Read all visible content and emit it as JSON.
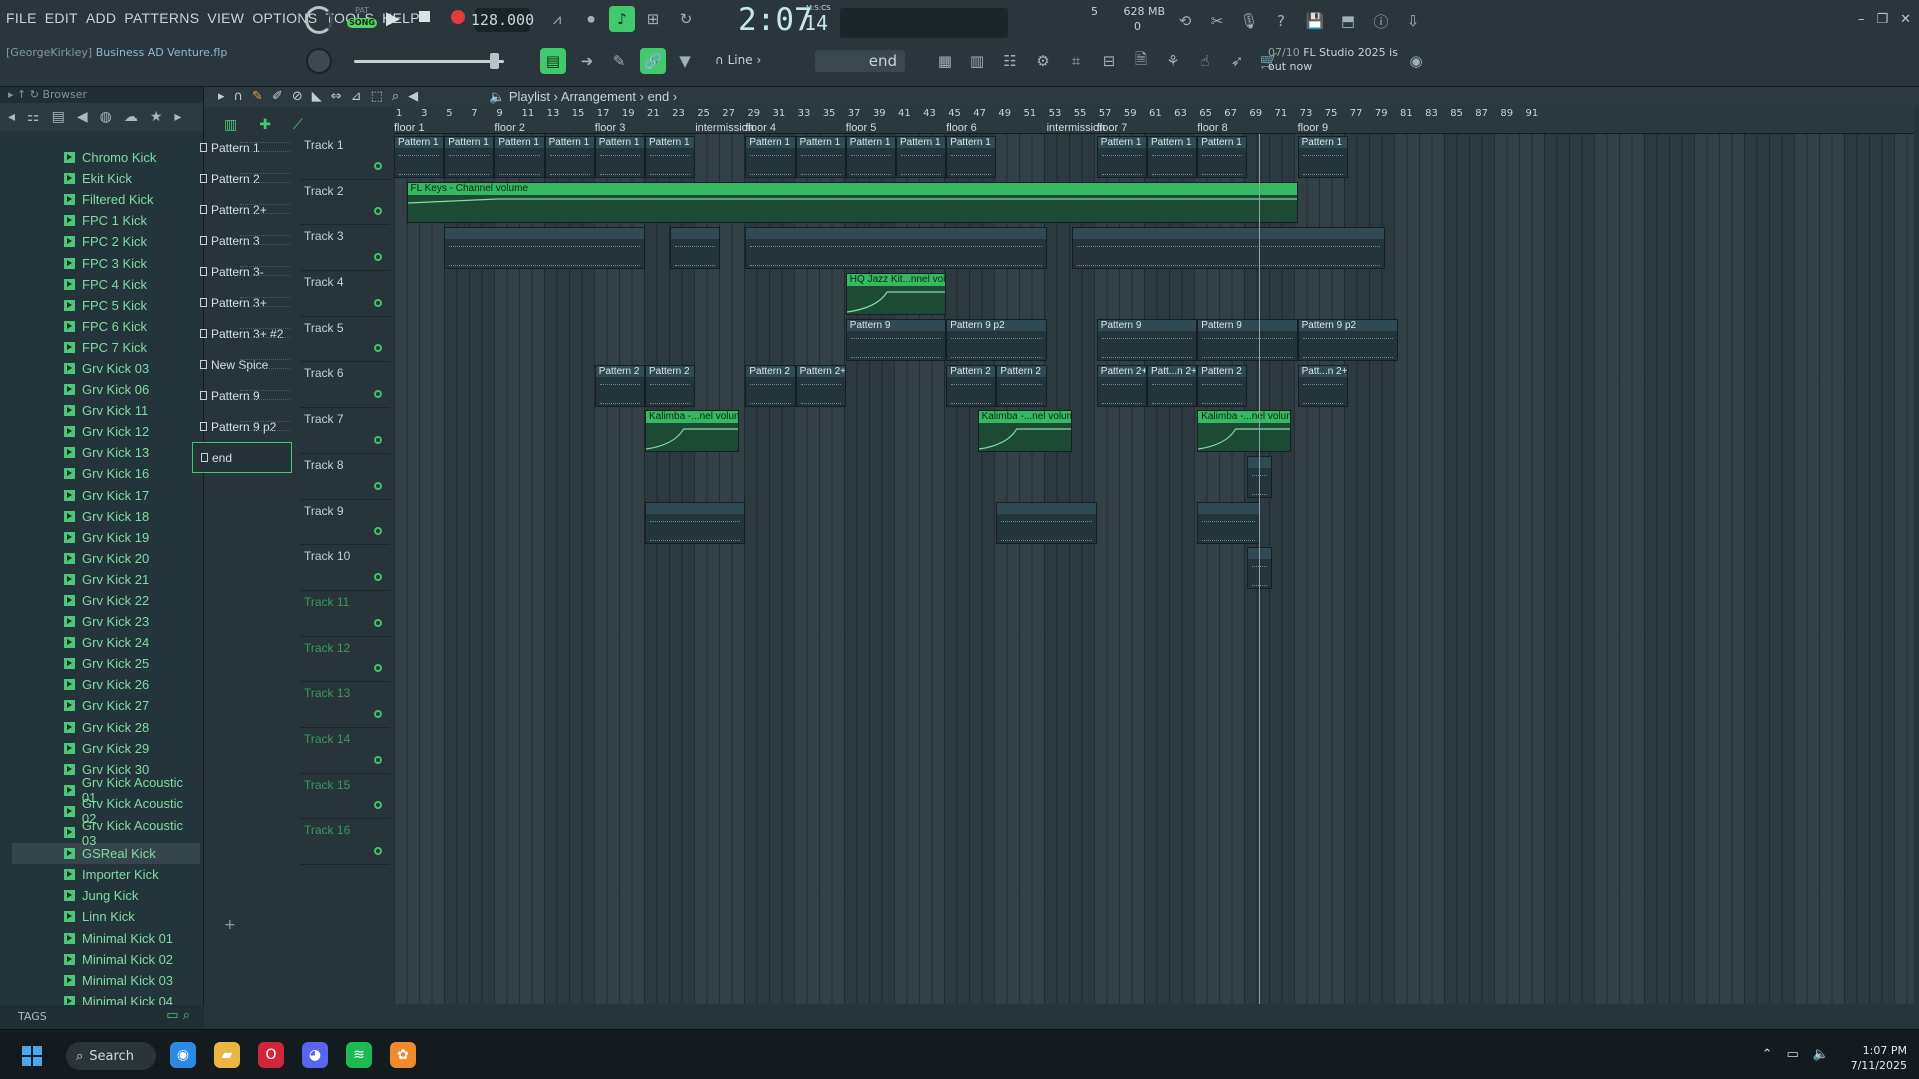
{
  "menu": [
    "FILE",
    "EDIT",
    "ADD",
    "PATTERNS",
    "VIEW",
    "OPTIONS",
    "TOOLS",
    "HELP"
  ],
  "transport": {
    "pat_label": "PAT",
    "song_label": "SONG",
    "tempo": "128.000",
    "time_main": "2:07",
    "time_sub": "14",
    "time_unit": "M:S:CS"
  },
  "cpu": {
    "memory": "628 MB",
    "count": "5",
    "zero": "0"
  },
  "project": {
    "user": "[GeorgeKirkley]",
    "file": "Business AD Venture.flp"
  },
  "snap": {
    "label": "Line"
  },
  "pattern_selector": {
    "value": "end"
  },
  "news": {
    "date": "07/10",
    "text": "FL Studio 2025 is",
    "text2": "out now"
  },
  "browser": {
    "header": "Browser",
    "items": [
      "Chromo Kick",
      "Ekit Kick",
      "Filtered Kick",
      "FPC 1 Kick",
      "FPC 2 Kick",
      "FPC 3 Kick",
      "FPC 4 Kick",
      "FPC 5 Kick",
      "FPC 6 Kick",
      "FPC 7 Kick",
      "Grv Kick 03",
      "Grv Kick 06",
      "Grv Kick 11",
      "Grv Kick 12",
      "Grv Kick 13",
      "Grv Kick 16",
      "Grv Kick 17",
      "Grv Kick 18",
      "Grv Kick 19",
      "Grv Kick 20",
      "Grv Kick 21",
      "Grv Kick 22",
      "Grv Kick 23",
      "Grv Kick 24",
      "Grv Kick 25",
      "Grv Kick 26",
      "Grv Kick 27",
      "Grv Kick 28",
      "Grv Kick 29",
      "Grv Kick 30",
      "Grv Kick Acoustic 01",
      "Grv Kick Acoustic 02",
      "Grv Kick Acoustic 03",
      "GSReal Kick",
      "Importer Kick",
      "Jung Kick",
      "Linn Kick",
      "Minimal Kick 01",
      "Minimal Kick 02",
      "Minimal Kick 03",
      "Minimal Kick 04"
    ],
    "selected": "GSReal Kick",
    "tags_label": "TAGS"
  },
  "playlist": {
    "breadcrumb": [
      "Playlist",
      "Arrangement",
      "end"
    ],
    "picker_tabs": [
      "NOTE",
      "CHAN",
      "PAT"
    ],
    "patterns": [
      "Pattern 1",
      "Pattern 2",
      "Pattern 2+",
      "Pattern 3",
      "Pattern 3-",
      "Pattern 3+",
      "Pattern 3+ #2",
      "New Spice",
      "Pattern 9",
      "Pattern 9 p2",
      "end"
    ],
    "selected_pattern": "end",
    "tracks": [
      "Track 1",
      "Track 2",
      "Track 3",
      "Track 4",
      "Track 5",
      "Track 6",
      "Track 7",
      "Track 8",
      "Track 9",
      "Track 10",
      "Track 11",
      "Track 12",
      "Track 13",
      "Track 14",
      "Track 15",
      "Track 16"
    ],
    "ruler_numbers": [
      "1",
      "3",
      "5",
      "7",
      "9",
      "11",
      "13",
      "15",
      "17",
      "19",
      "21",
      "23",
      "25",
      "27",
      "29",
      "31",
      "33",
      "35",
      "37",
      "39",
      "41",
      "43",
      "45",
      "47",
      "49",
      "51",
      "53",
      "55",
      "57",
      "59",
      "61",
      "63",
      "65",
      "67",
      "69",
      "71",
      "73",
      "75",
      "77",
      "79",
      "81",
      "83",
      "85",
      "87",
      "89",
      "91"
    ],
    "markers": [
      {
        "label": "floor 1",
        "bar": 1
      },
      {
        "label": "floor 2",
        "bar": 9
      },
      {
        "label": "floor 3",
        "bar": 17
      },
      {
        "label": "intermission",
        "bar": 25
      },
      {
        "label": "floor 4",
        "bar": 29
      },
      {
        "label": "floor 5",
        "bar": 37
      },
      {
        "label": "floor 6",
        "bar": 45
      },
      {
        "label": "intermission",
        "bar": 53
      },
      {
        "label": "floor 7",
        "bar": 57
      },
      {
        "label": "floor 8",
        "bar": 65
      },
      {
        "label": "floor 9",
        "bar": 73
      }
    ],
    "clips": [
      {
        "track": 1,
        "start": 1,
        "len": 4,
        "label": "Pattern 1",
        "kind": "pat"
      },
      {
        "track": 1,
        "start": 5,
        "len": 4,
        "label": "Pattern 1",
        "kind": "pat"
      },
      {
        "track": 1,
        "start": 9,
        "len": 4,
        "label": "Pattern 1",
        "kind": "pat"
      },
      {
        "track": 1,
        "start": 13,
        "len": 4,
        "label": "Pattern 1",
        "kind": "pat"
      },
      {
        "track": 1,
        "start": 17,
        "len": 4,
        "label": "Pattern 1",
        "kind": "pat"
      },
      {
        "track": 1,
        "start": 21,
        "len": 4,
        "label": "Pattern 1",
        "kind": "pat"
      },
      {
        "track": 1,
        "start": 29,
        "len": 4,
        "label": "Pattern 1",
        "kind": "pat"
      },
      {
        "track": 1,
        "start": 33,
        "len": 4,
        "label": "Pattern 1",
        "kind": "pat"
      },
      {
        "track": 1,
        "start": 37,
        "len": 4,
        "label": "Pattern 1",
        "kind": "pat"
      },
      {
        "track": 1,
        "start": 41,
        "len": 4,
        "label": "Pattern 1",
        "kind": "pat"
      },
      {
        "track": 1,
        "start": 45,
        "len": 4,
        "label": "Pattern 1",
        "kind": "pat"
      },
      {
        "track": 1,
        "start": 57,
        "len": 4,
        "label": "Pattern 1",
        "kind": "pat"
      },
      {
        "track": 1,
        "start": 61,
        "len": 4,
        "label": "Pattern 1",
        "kind": "pat"
      },
      {
        "track": 1,
        "start": 65,
        "len": 4,
        "label": "Pattern 1",
        "kind": "pat"
      },
      {
        "track": 1,
        "start": 73,
        "len": 4,
        "label": "Pattern 1",
        "kind": "pat"
      },
      {
        "track": 2,
        "start": 2,
        "len": 71,
        "label": "FL Keys - Channel volume",
        "kind": "auto"
      },
      {
        "track": 3,
        "start": 5,
        "len": 16,
        "label": "",
        "kind": "pat"
      },
      {
        "track": 3,
        "start": 23,
        "len": 4,
        "label": "",
        "kind": "pat"
      },
      {
        "track": 3,
        "start": 29,
        "len": 24,
        "label": "",
        "kind": "pat"
      },
      {
        "track": 3,
        "start": 55,
        "len": 25,
        "label": "",
        "kind": "pat"
      },
      {
        "track": 4,
        "start": 37,
        "len": 8,
        "label": "HQ Jazz Kit...nnel volume",
        "kind": "auto"
      },
      {
        "track": 5,
        "start": 37,
        "len": 8,
        "label": "Pattern 9",
        "kind": "pat"
      },
      {
        "track": 5,
        "start": 45,
        "len": 8,
        "label": "Pattern 9 p2",
        "kind": "pat"
      },
      {
        "track": 5,
        "start": 57,
        "len": 8,
        "label": "Pattern 9",
        "kind": "pat"
      },
      {
        "track": 5,
        "start": 65,
        "len": 8,
        "label": "Pattern 9",
        "kind": "pat"
      },
      {
        "track": 5,
        "start": 73,
        "len": 8,
        "label": "Pattern 9 p2",
        "kind": "pat"
      },
      {
        "track": 6,
        "start": 17,
        "len": 4,
        "label": "Pattern 2",
        "kind": "pat"
      },
      {
        "track": 6,
        "start": 21,
        "len": 4,
        "label": "Pattern 2",
        "kind": "pat"
      },
      {
        "track": 6,
        "start": 29,
        "len": 4,
        "label": "Pattern 2",
        "kind": "pat"
      },
      {
        "track": 6,
        "start": 33,
        "len": 4,
        "label": "Pattern 2+",
        "kind": "pat"
      },
      {
        "track": 6,
        "start": 45,
        "len": 4,
        "label": "Pattern 2",
        "kind": "pat"
      },
      {
        "track": 6,
        "start": 49,
        "len": 4,
        "label": "Pattern 2",
        "kind": "pat"
      },
      {
        "track": 6,
        "start": 57,
        "len": 4,
        "label": "Pattern 2+",
        "kind": "pat"
      },
      {
        "track": 6,
        "start": 61,
        "len": 4,
        "label": "Patt...n 2+",
        "kind": "pat"
      },
      {
        "track": 6,
        "start": 65,
        "len": 4,
        "label": "Pattern 2",
        "kind": "pat"
      },
      {
        "track": 6,
        "start": 73,
        "len": 4,
        "label": "Patt...n 2+",
        "kind": "pat"
      },
      {
        "track": 7,
        "start": 21,
        "len": 7.5,
        "label": "Kalimba -...nel volume",
        "kind": "auto"
      },
      {
        "track": 7,
        "start": 47.5,
        "len": 7.5,
        "label": "Kalimba -...nel volume",
        "kind": "auto"
      },
      {
        "track": 7,
        "start": 65,
        "len": 7.5,
        "label": "Kalimba -...nel volume",
        "kind": "auto"
      },
      {
        "track": 8,
        "start": 69,
        "len": 2,
        "label": "",
        "kind": "pat"
      },
      {
        "track": 9,
        "start": 21,
        "len": 8,
        "label": "",
        "kind": "pat"
      },
      {
        "track": 9,
        "start": 49,
        "len": 8,
        "label": "",
        "kind": "pat"
      },
      {
        "track": 9,
        "start": 65,
        "len": 5,
        "label": "",
        "kind": "pat"
      },
      {
        "track": 10,
        "start": 69,
        "len": 2,
        "label": "",
        "kind": "pat"
      }
    ]
  },
  "taskbar": {
    "search": "Search",
    "time": "1:07 PM",
    "date": "7/11/2025"
  },
  "colors": {
    "accent": "#42c96d",
    "background": "#27343a",
    "record": "#e23c3c"
  }
}
